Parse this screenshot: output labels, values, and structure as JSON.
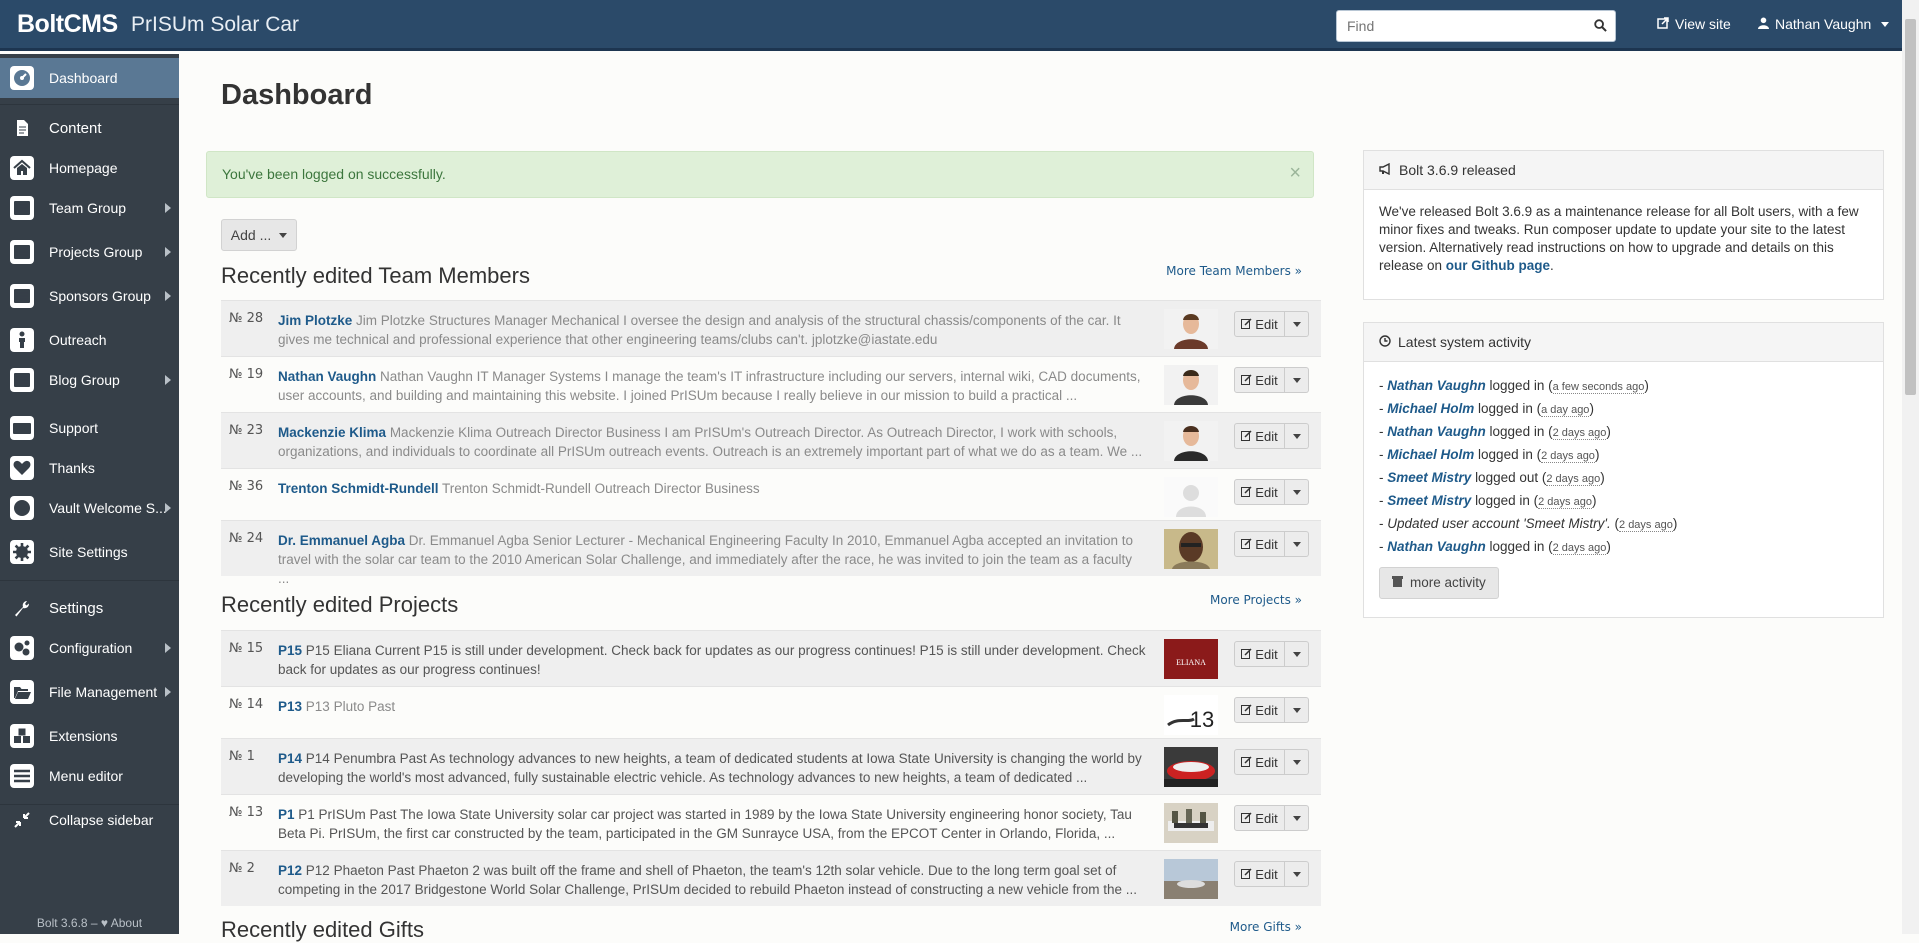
{
  "topbar": {
    "brand": "BoltCMS",
    "site_name": "PrISUm Solar Car",
    "search_placeholder": "Find",
    "view_site": "View site",
    "user": "Nathan Vaughn"
  },
  "sidebar": {
    "items": [
      {
        "label": "Dashboard",
        "icon": "dashboard-icon"
      },
      {
        "label": "Content",
        "icon": "file-icon"
      },
      {
        "label": "Homepage",
        "icon": "home-icon"
      },
      {
        "label": "Team Group",
        "icon": "list-icon"
      },
      {
        "label": "Projects Group",
        "icon": "list-icon"
      },
      {
        "label": "Sponsors Group",
        "icon": "list-icon"
      },
      {
        "label": "Outreach",
        "icon": "child-icon"
      },
      {
        "label": "Blog Group",
        "icon": "list-icon"
      },
      {
        "label": "Support",
        "icon": "money-icon"
      },
      {
        "label": "Thanks",
        "icon": "heart-icon"
      },
      {
        "label": "Vault Welcome S...",
        "icon": "internet-explorer-icon"
      },
      {
        "label": "Site Settings",
        "icon": "gear-icon"
      },
      {
        "label": "Settings",
        "icon": "wrench-icon"
      },
      {
        "label": "Configuration",
        "icon": "gears-icon"
      },
      {
        "label": "File Management",
        "icon": "folder-open-icon"
      },
      {
        "label": "Extensions",
        "icon": "cubes-icon"
      },
      {
        "label": "Menu editor",
        "icon": "bars-icon"
      },
      {
        "label": "Collapse sidebar",
        "icon": "compress-icon"
      }
    ],
    "footer": "Bolt 3.6.8 – ♥ About"
  },
  "main": {
    "title": "Dashboard",
    "alert": "You've been logged on successfully.",
    "add_button": "Add ...",
    "team": {
      "title": "Recently edited Team Members",
      "more": "More Team Members »",
      "rows": [
        {
          "num": "№ 28",
          "title": "Jim Plotzke",
          "text": "Jim Plotzke Structures Manager Mechanical I oversee the design and analysis of the structural chassis/components of the car. It gives me technical and professional experience that other engineering teams/clubs can't. jplotzke@iastate.edu"
        },
        {
          "num": "№ 19",
          "title": "Nathan Vaughn",
          "text": "Nathan Vaughn IT Manager Systems I manage the team's IT infrastructure including our servers, internal wiki, CAD documents, user accounts, and building and maintaining this website. I joined PrISUm because I really believe in our mission to build a practical ..."
        },
        {
          "num": "№ 23",
          "title": "Mackenzie Klima",
          "text": "Mackenzie Klima Outreach Director Business I am PrISUm's Outreach Director. As Outreach Director, I work with schools, organizations, and individuals to coordinate all PrISUm outreach events. Outreach is an extremely important part of what we do as a team. We ..."
        },
        {
          "num": "№ 36",
          "title": "Trenton Schmidt-Rundell",
          "text": "Trenton Schmidt-Rundell Outreach Director Business"
        },
        {
          "num": "№ 24",
          "title": "Dr. Emmanuel Agba",
          "text": "Dr. Emmanuel Agba Senior Lecturer - Mechanical Engineering Faculty In 2010, Emmanuel Agba accepted an invitation to travel with the solar car team to the 2010 American Solar Challenge, and immediately after the race, he was invited to join the team as a faculty ..."
        }
      ]
    },
    "projects": {
      "title": "Recently edited Projects",
      "more": "More Projects »",
      "rows": [
        {
          "num": "№ 15",
          "title": "P15",
          "text": "P15 Eliana Current P15 is still under development. Check back for updates as our progress continues! P15 is still under development. Check back for updates as our progress continues!",
          "thumb_text": "ELIANA"
        },
        {
          "num": "№ 14",
          "title": "P13",
          "text": "P13 Pluto Past",
          "thumb_text": "13"
        },
        {
          "num": "№ 1",
          "title": "P14",
          "text": "P14 Penumbra Past As technology advances to new heights, a team of dedicated students at Iowa State University is changing the world by developing the world's most advanced, fully sustainable electric vehicle. As technology advances to new heights, a team of dedicated ..."
        },
        {
          "num": "№ 13",
          "title": "P1",
          "text": "P1 PrISUm Past The Iowa State University solar car project was started in 1989 by the Iowa State University engineering honor society, Tau Beta Pi. PrISUm, the first car constructed by the team, participated in the GM Sunrayce USA, from the EPCOT Center in Orlando, Florida, ..."
        },
        {
          "num": "№ 2",
          "title": "P12",
          "text": "P12 Phaeton Past Phaeton 2 was built off the frame and shell of Phaeton, the team's 12th solar vehicle. Due to the long term goal set of competing in the 2017 Bridgestone World Solar Challenge, PrISUm decided to rebuild Phaeton instead of constructing a new vehicle from the ..."
        }
      ]
    },
    "gifts": {
      "title": "Recently edited Gifts",
      "more": "More Gifts »"
    },
    "edit_label": "Edit"
  },
  "news": {
    "title": "Bolt 3.6.9 released",
    "body": "We've released Bolt 3.6.9 as a maintenance release for all Bolt users, with a few minor fixes and tweaks. Run composer update to update your site to the latest version. Alternatively read instructions on how to upgrade and details on this release on ",
    "link": "our Github page",
    "end": "."
  },
  "activity": {
    "title": "Latest system activity",
    "entries": [
      {
        "user": "Nathan Vaughn",
        "action": "logged in",
        "ago": "a few seconds ago"
      },
      {
        "user": "Michael Holm",
        "action": "logged in",
        "ago": "a day ago"
      },
      {
        "user": "Nathan Vaughn",
        "action": "logged in",
        "ago": "2 days ago"
      },
      {
        "user": "Michael Holm",
        "action": "logged in",
        "ago": "2 days ago"
      },
      {
        "user": "Smeet Mistry",
        "action": "logged out",
        "ago": "2 days ago"
      },
      {
        "user": "Smeet Mistry",
        "action": "logged in",
        "ago": "2 days ago"
      },
      {
        "user": "",
        "action": "Updated user account 'Smeet Mistry'.",
        "ago": "2 days ago"
      },
      {
        "user": "Nathan Vaughn",
        "action": "logged in",
        "ago": "2 days ago"
      }
    ],
    "more": "more activity"
  }
}
